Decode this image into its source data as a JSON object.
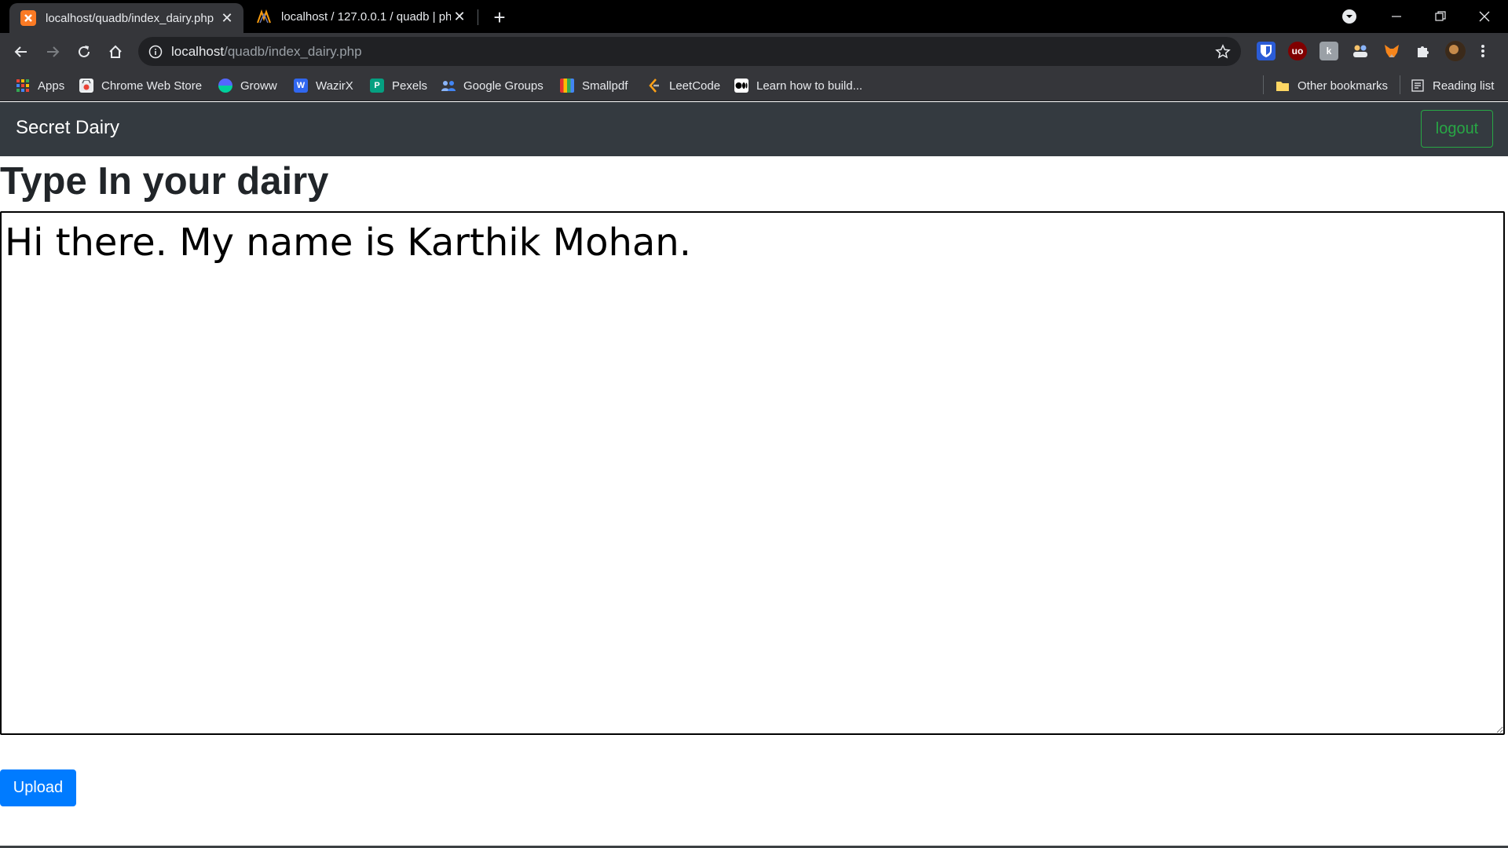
{
  "browser": {
    "tabs": [
      {
        "title": "localhost/quadb/index_dairy.php",
        "active": true,
        "icon": "xampp-icon"
      },
      {
        "title": "localhost / 127.0.0.1 / quadb | ph",
        "active": false,
        "icon": "phpmyadmin-icon"
      }
    ],
    "url_host": "localhost",
    "url_path": "/quadb/index_dairy.php",
    "bookmarks": [
      {
        "label": "Apps",
        "icon": "apps-grid-icon",
        "color": "#4285f4"
      },
      {
        "label": "Chrome Web Store",
        "icon": "webstore-icon",
        "color": "#ea4335"
      },
      {
        "label": "Groww",
        "icon": "groww-icon",
        "color": "#5367ff"
      },
      {
        "label": "WazirX",
        "icon": "wazirx-icon",
        "color": "#3067f0"
      },
      {
        "label": "Pexels",
        "icon": "pexels-icon",
        "color": "#05a081"
      },
      {
        "label": "Google Groups",
        "icon": "google-groups-icon",
        "color": "#4285f4"
      },
      {
        "label": "Smallpdf",
        "icon": "smallpdf-icon",
        "color": "#e5322d"
      },
      {
        "label": "LeetCode",
        "icon": "leetcode-icon",
        "color": "#ffa116"
      },
      {
        "label": "Learn how to build...",
        "icon": "medium-icon",
        "color": "#ffffff"
      }
    ],
    "other_bookmarks": "Other bookmarks",
    "reading_list": "Reading list"
  },
  "page": {
    "brand": "Secret Dairy",
    "logout_label": "logout",
    "heading": "Type In your dairy",
    "diary_text": "Hi there. My name is Karthik Mohan.",
    "upload_label": "Upload"
  },
  "colors": {
    "navbar": "#343a40",
    "logout": "#28a745",
    "upload": "#007bff"
  }
}
